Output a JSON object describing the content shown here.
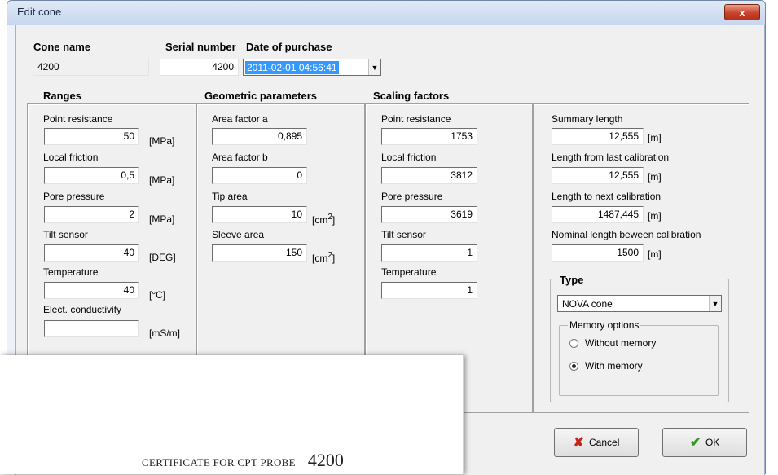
{
  "window": {
    "title": "Edit cone",
    "close_glyph": "x"
  },
  "cone_name": {
    "label": "Cone name",
    "value": "4200"
  },
  "serial_number": {
    "label": "Serial number",
    "value": "4200"
  },
  "date_of_purchase": {
    "label": "Date of purchase",
    "value": "2011-02-01 04:56:41"
  },
  "ranges": {
    "header": "Ranges",
    "items": [
      {
        "label": "Point resistance",
        "value": "50",
        "unit": "[MPa]"
      },
      {
        "label": "Local friction",
        "value": "0,5",
        "unit": "[MPa]"
      },
      {
        "label": "Pore pressure",
        "value": "2",
        "unit": "[MPa]"
      },
      {
        "label": "Tilt sensor",
        "value": "40",
        "unit": "[DEG]"
      },
      {
        "label": "Temperature",
        "value": "40",
        "unit": "[°C]"
      },
      {
        "label": "Elect. conductivity",
        "value": "",
        "unit": "[mS/m]"
      }
    ]
  },
  "geometric": {
    "header": "Geometric parameters",
    "items": [
      {
        "label": "Area factor a",
        "value": "0,895",
        "unit": ""
      },
      {
        "label": "Area factor b",
        "value": "0",
        "unit": ""
      },
      {
        "label": "Tip area",
        "value": "10",
        "unit": "[cm",
        "sup": "2",
        "unit_end": "]"
      },
      {
        "label": "Sleeve area",
        "value": "150",
        "unit": "[cm",
        "sup": "2",
        "unit_end": "]"
      }
    ]
  },
  "scaling": {
    "header": "Scaling factors",
    "items": [
      {
        "label": "Point resistance",
        "value": "1753"
      },
      {
        "label": "Local friction",
        "value": "3812"
      },
      {
        "label": "Pore pressure",
        "value": "3619"
      },
      {
        "label": "Tilt sensor",
        "value": "1"
      },
      {
        "label": "Temperature",
        "value": "1"
      }
    ]
  },
  "lengths": {
    "items": [
      {
        "label": "Summary length",
        "value": "12,555",
        "unit": "[m]"
      },
      {
        "label": "Length from last calibration",
        "value": "12,555",
        "unit": "[m]"
      },
      {
        "label": "Length to next calibration",
        "value": "1487,445",
        "unit": "[m]"
      },
      {
        "label": "Nominal length beween calibration",
        "value": "1500",
        "unit": "[m]"
      }
    ]
  },
  "type": {
    "label": "Type",
    "selected": "NOVA cone",
    "memory_options": {
      "label": "Memory options",
      "options": [
        "Without memory",
        "With memory"
      ],
      "selected_index": 1
    }
  },
  "buttons": {
    "cancel": "Cancel",
    "ok": "OK"
  },
  "certificate": {
    "text": "CERTIFICATE FOR CPT PROBE",
    "number": "4200"
  },
  "colors": {
    "cancel_icon": "#c0261c",
    "ok_icon": "#2e9a1e",
    "selection": "#3399ff"
  }
}
